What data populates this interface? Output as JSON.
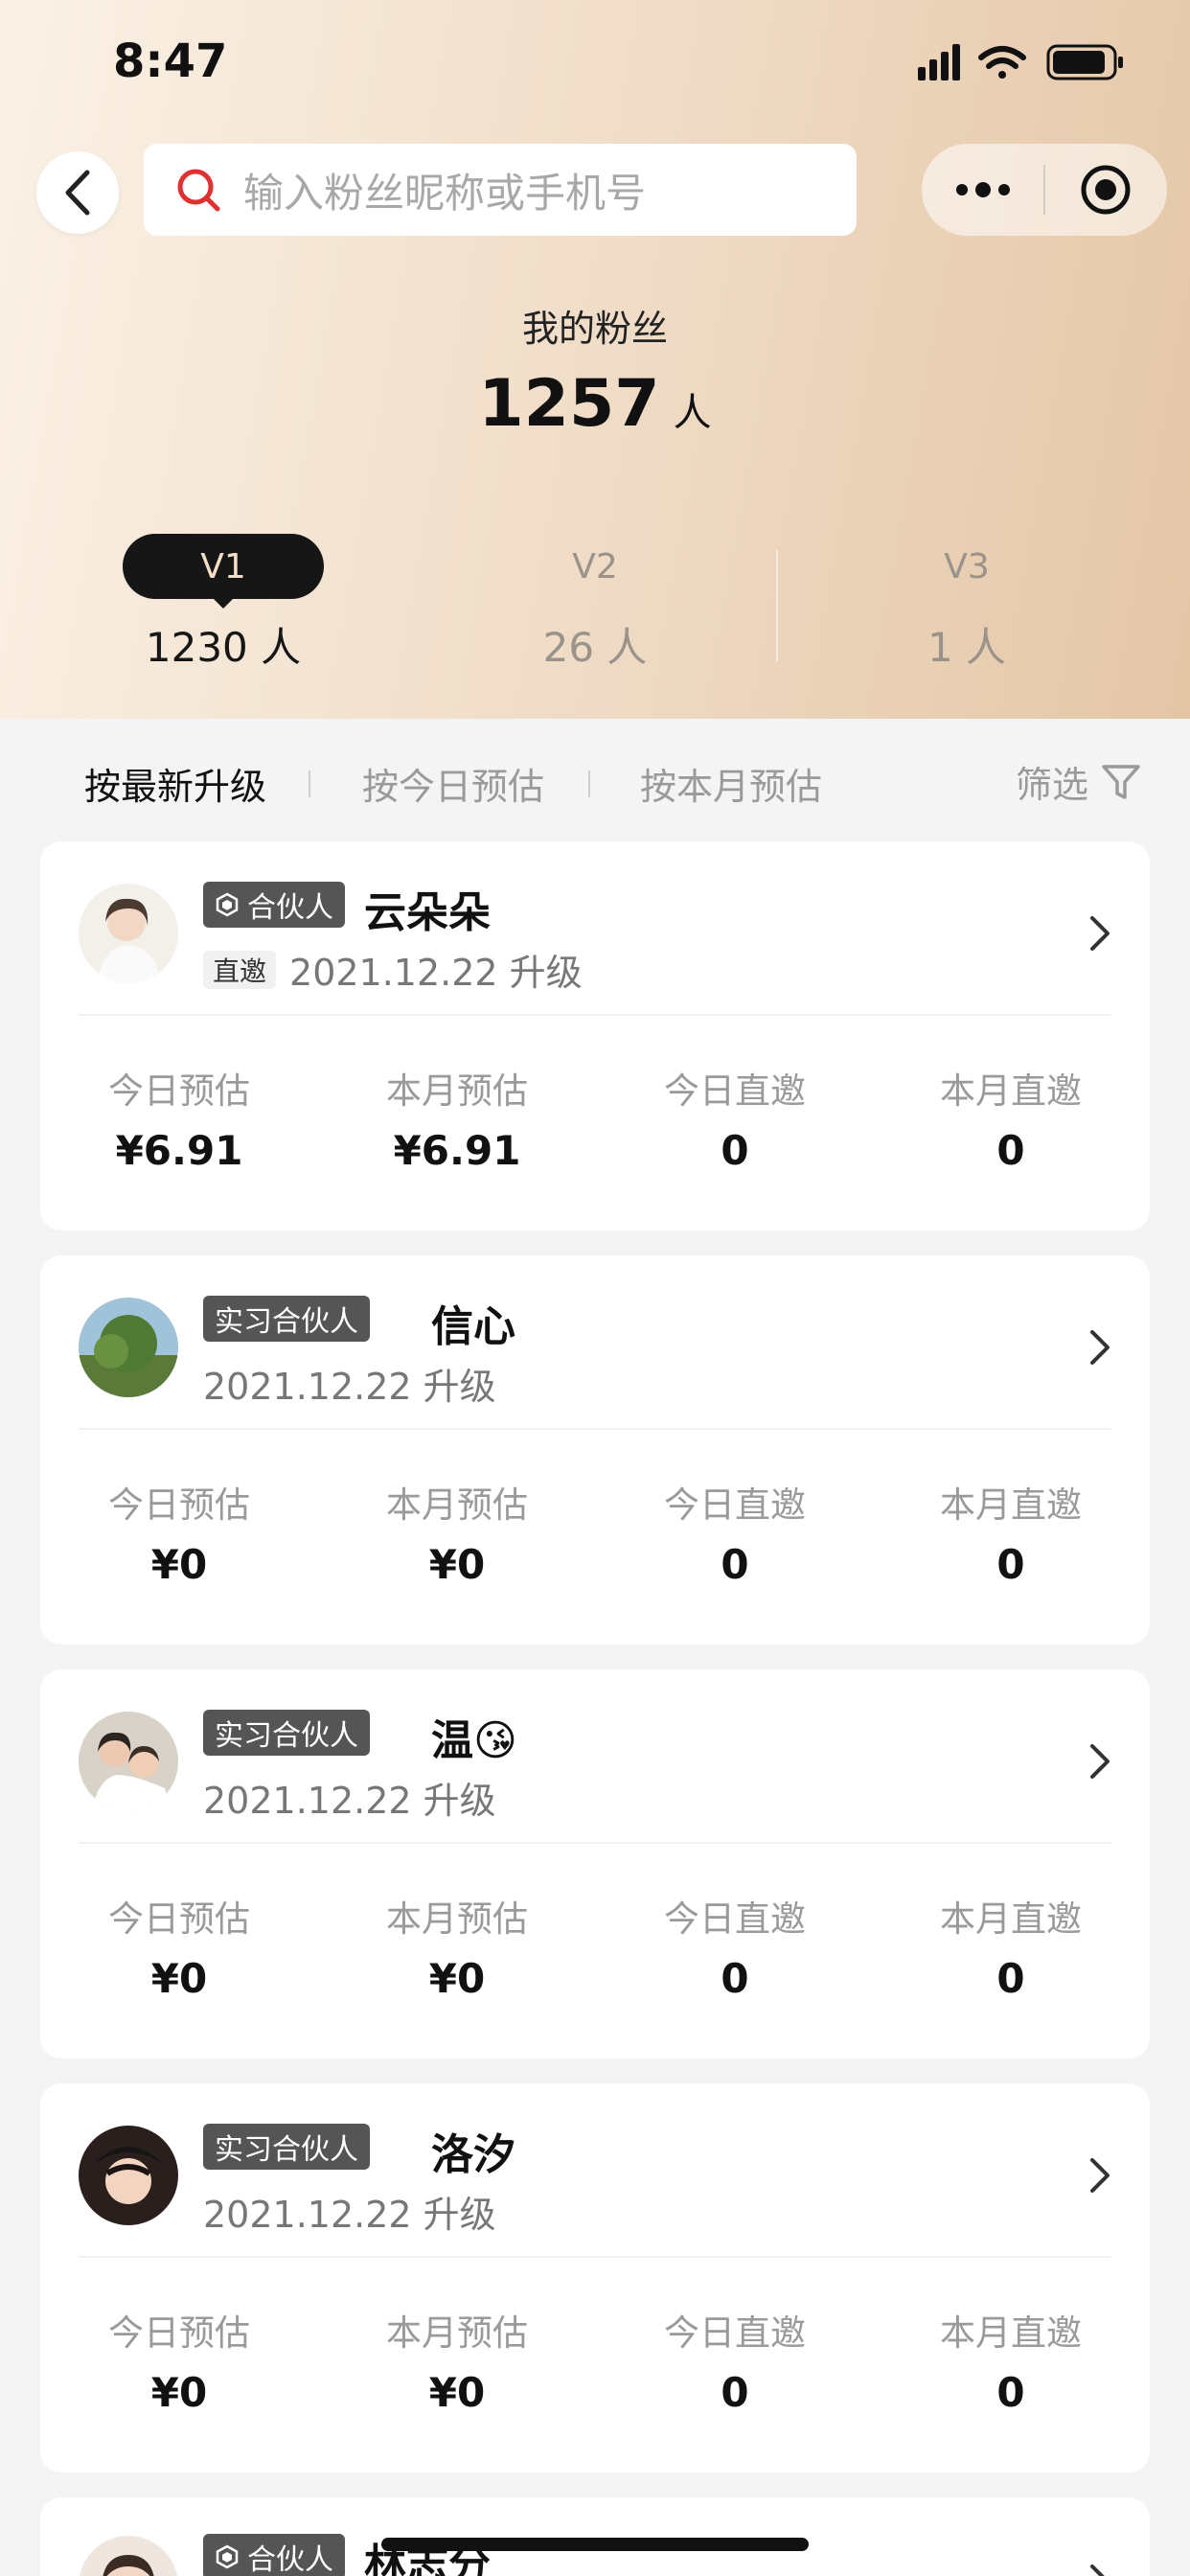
{
  "status_bar": {
    "time": "8:47"
  },
  "search": {
    "placeholder": "输入粉丝昵称或手机号"
  },
  "summary": {
    "title": "我的粉丝",
    "count": "1257",
    "unit": "人"
  },
  "levels": [
    {
      "label": "V1",
      "count": "1230 人",
      "active": true
    },
    {
      "label": "V2",
      "count": "26 人",
      "active": false
    },
    {
      "label": "V3",
      "count": "1 人",
      "active": false
    }
  ],
  "sort_tabs": [
    {
      "label": "按最新升级",
      "active": true
    },
    {
      "label": "按今日预估",
      "active": false
    },
    {
      "label": "按本月预估",
      "active": false
    }
  ],
  "filter_label": "筛选",
  "stat_labels": [
    "今日预估",
    "本月预估",
    "今日直邀",
    "本月直邀"
  ],
  "fans": [
    {
      "badge": "合伙人",
      "badge_icon": "hexagon-icon",
      "name": "云朵朵",
      "direct_tag": "直邀",
      "date": "2021.12.22 升级",
      "stats": [
        "¥6.91",
        "¥6.91",
        "0",
        "0"
      ]
    },
    {
      "badge": "实习合伙人",
      "name": "信心",
      "date": "2021.12.22 升级",
      "stats": [
        "¥0",
        "¥0",
        "0",
        "0"
      ]
    },
    {
      "badge": "实习合伙人",
      "name": "温😘",
      "date": "2021.12.22 升级",
      "stats": [
        "¥0",
        "¥0",
        "0",
        "0"
      ]
    },
    {
      "badge": "实习合伙人",
      "name": "洛汐",
      "date": "2021.12.22 升级",
      "stats": [
        "¥0",
        "¥0",
        "0",
        "0"
      ]
    },
    {
      "badge": "合伙人",
      "badge_icon": "hexagon-icon",
      "name": "林志分"
    }
  ]
}
